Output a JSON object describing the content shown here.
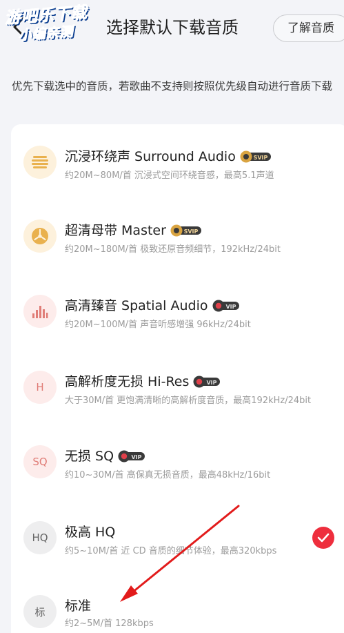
{
  "header": {
    "title": "选择默认下载音质",
    "learn_label": "了解音质",
    "watermark_line1": "游吧乐下载",
    "watermark_line2": "小编亲测"
  },
  "description": "优先下载选中的音质，若歌曲不支持则按照优先级自动进行音质下载",
  "badges": {
    "svip": "SVIP",
    "vip": "VIP"
  },
  "options": [
    {
      "name": "沉浸环绕声  Surround Audio",
      "sub": "约20M~80M/首 沉浸式空间环绕音感，最高5.1声道",
      "badge": "svip",
      "icon": "surround-audio-icon",
      "selected": false
    },
    {
      "name": "超清母带  Master",
      "sub": "约20M~180M/首 极致还原音频细节，192kHz/24bit",
      "badge": "svip",
      "icon": "master-icon",
      "selected": false
    },
    {
      "name": "高清臻音  Spatial Audio",
      "sub": "约20M~100M/首 声音听感增强 96kHz/24bit",
      "badge": "vip",
      "icon": "spatial-audio-icon",
      "selected": false
    },
    {
      "name": "高解析度无损  Hi-Res",
      "sub": "大于30M/首 更饱满清晰的高解析度音质，最高192kHz/24bit",
      "badge": "vip",
      "icon": "hires-icon",
      "icon_text": "H",
      "selected": false
    },
    {
      "name": "无损  SQ",
      "sub": "约10~30M/首 高保真无损音质，最高48kHz/16bit",
      "badge": "vip",
      "icon": "sq-icon",
      "icon_text": "SQ",
      "selected": false
    },
    {
      "name": "极高  HQ",
      "sub": "约5~10M/首 近 CD 音质的细节体验，最高320kbps",
      "badge": "",
      "icon": "hq-icon",
      "icon_text": "HQ",
      "selected": true
    },
    {
      "name": "标准",
      "sub": "约2~5M/首 128kbps",
      "badge": "",
      "icon": "standard-icon",
      "icon_text": "标",
      "selected": false
    }
  ],
  "colors": {
    "accent_red": "#ee2e3d",
    "gold_badge": "#d9a441",
    "dark_badge": "#3a3a3a",
    "gold_icon_bg": "#fdf1dc",
    "red_icon_bg": "#fdeceb",
    "gray_icon_bg": "#eeeeef"
  }
}
